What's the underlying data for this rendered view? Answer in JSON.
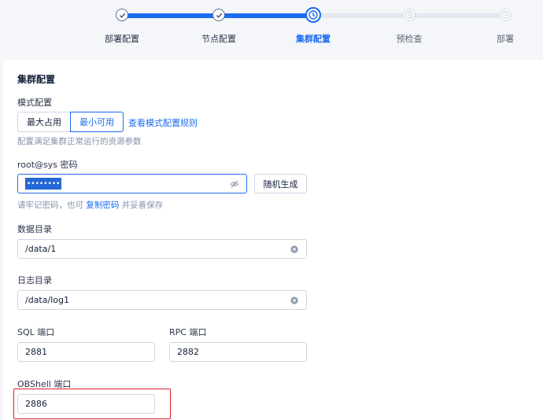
{
  "stepper": {
    "steps": [
      {
        "label": "部署配置",
        "state": "done"
      },
      {
        "label": "节点配置",
        "state": "done"
      },
      {
        "label": "集群配置",
        "state": "current"
      },
      {
        "label": "预检查",
        "state": "todo"
      },
      {
        "label": "部署",
        "state": "todo"
      }
    ]
  },
  "cluster": {
    "section_title": "集群配置",
    "mode": {
      "label": "模式配置",
      "options": [
        "最大占用",
        "最小可用"
      ],
      "selected": "最小可用",
      "rules_link": "查看模式配置规则",
      "helper": "配置满足集群正常运行的资源参数"
    },
    "password": {
      "label": "root@sys 密码",
      "value_mask": "••••••••",
      "generate_button": "随机生成",
      "helper_prefix": "请牢记密码，也可",
      "helper_link": "复制密码",
      "helper_suffix": "并妥善保存",
      "toggle_icon": "eye-off-icon"
    },
    "data_dir": {
      "label": "数据目录",
      "value": "/data/1",
      "clear_icon": "clear-circle-icon"
    },
    "log_dir": {
      "label": "日志目录",
      "value": "/data/log1",
      "clear_icon": "clear-circle-icon"
    },
    "sql_port": {
      "label": "SQL 端口",
      "value": "2881"
    },
    "rpc_port": {
      "label": "RPC 端口",
      "value": "2882"
    },
    "obshell_port": {
      "label": "OBShell 端口",
      "value": "2886"
    }
  },
  "colors": {
    "accent": "#1c6cf0",
    "highlight": "#d8202b",
    "border": "#cdd5e4",
    "background": "#f5f6f9"
  }
}
